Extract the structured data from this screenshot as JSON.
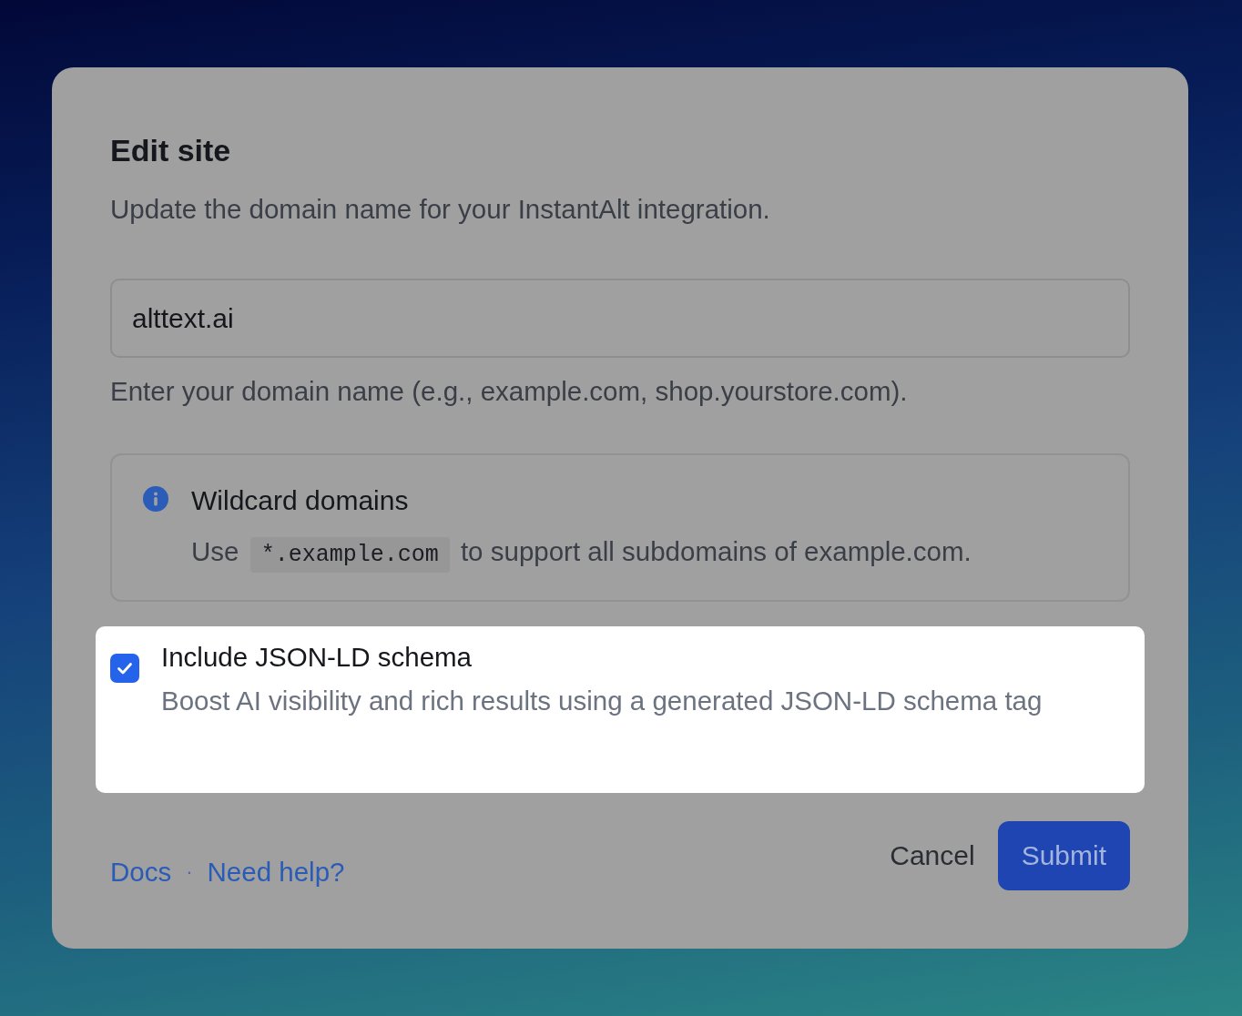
{
  "dialog": {
    "title": "Edit site",
    "description": "Update the domain name for your InstantAlt integration.",
    "domain_field": {
      "value": "alttext.ai",
      "hint": "Enter your domain name (e.g., example.com, shop.yourstore.com)."
    },
    "notice": {
      "title": "Wildcard domains",
      "text_before": "Use",
      "code": "*.example.com",
      "text_after": "to support all subdomains of example.com."
    },
    "option": {
      "label": "Include JSON-LD schema",
      "description": "Boost AI visibility and rich results using a generated JSON-LD schema tag",
      "checked": true,
      "highlighted": true
    },
    "footer": {
      "links": [
        "Docs",
        "Need help?"
      ],
      "separator": "·",
      "buttons": [
        {
          "label": "Cancel",
          "kind": "secondary"
        },
        {
          "label": "Submit",
          "kind": "primary"
        }
      ]
    }
  }
}
